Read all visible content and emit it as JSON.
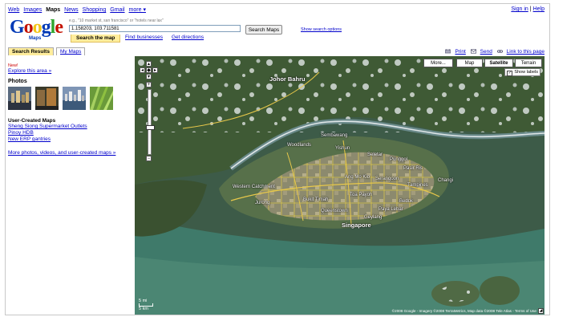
{
  "topnav": {
    "items": [
      "Web",
      "Images",
      "Maps",
      "News",
      "Shopping",
      "Gmail",
      "more ▾"
    ],
    "current": "Maps"
  },
  "account": {
    "sign_in": "Sign in",
    "separator": "|",
    "help": "Help"
  },
  "logo": {
    "word": "Google",
    "sub": "Maps"
  },
  "search": {
    "hint": "e.g., \"10 market st, san francisco\" or \"hotels near lax\"",
    "value": "1.158203, 103.711581",
    "button": "Search Maps",
    "show_options": "Show search options"
  },
  "search_tabs": [
    "Search the map",
    "Find businesses",
    "Get directions"
  ],
  "left_tabs": [
    "Search Results",
    "My Maps"
  ],
  "tools": {
    "print": "Print",
    "send": "Send",
    "link": "Link to this page"
  },
  "panel": {
    "new_badge": "New!",
    "explore": "Explore this area »",
    "photos_title": "Photos",
    "user_maps_title": "User-Created Maps",
    "user_maps": [
      "Sheng Siong Supermarket Outlets",
      "Pinoy HDB",
      "New ERP gantries"
    ],
    "more_link": "More photos, videos, and user-created maps »"
  },
  "map": {
    "view_buttons": [
      "More...",
      "Map",
      "Satellite",
      "Terrain"
    ],
    "active_view": "Satellite",
    "show_labels": "Show labels",
    "labels": [
      "Johor Bahru",
      "Singapore",
      "Woodlands",
      "Yishun",
      "Sembawang",
      "Bukit Timah",
      "Ang Mo Kio",
      "Serangoon",
      "Tampines",
      "Bedok",
      "Pasir Ris",
      "Jurong",
      "Western Catchment",
      "Toa Payoh",
      "Queenstown",
      "Paya Lebar",
      "Geylang",
      "Punggol",
      "Seletar",
      "Changi"
    ],
    "scale": [
      "5 mi",
      "5 km"
    ],
    "copyright": "©2008 Google - Imagery ©2008 TerraMetrics, Map data ©2008 Tele Atlas - Terms of Use"
  },
  "colors": {
    "link": "#0000cc",
    "active_tab": "#ffed9c",
    "new": "#cc0000"
  }
}
